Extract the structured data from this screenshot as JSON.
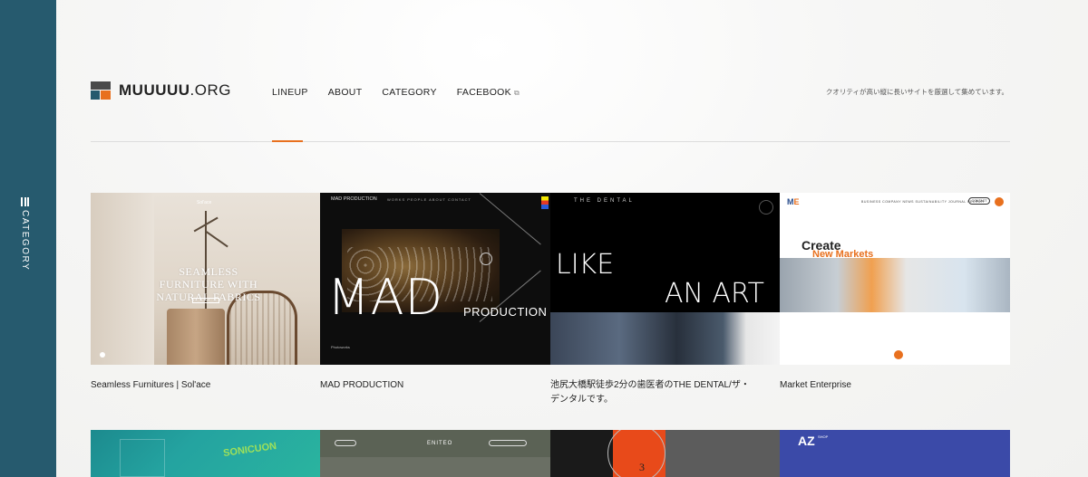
{
  "sidebar": {
    "label": "CATEGORY"
  },
  "header": {
    "logo_bold": "MUUUUU",
    "logo_rest": ".ORG",
    "nav": [
      {
        "label": "LINEUP"
      },
      {
        "label": "ABOUT"
      },
      {
        "label": "CATEGORY"
      },
      {
        "label": "FACEBOOK"
      }
    ],
    "tagline": "クオリティが高い縦に長いサイトを厳選して集めています。",
    "accent_color": "#e8701e",
    "sidebar_color": "#265a6e"
  },
  "cards": [
    {
      "caption": "Seamless Furnitures | Sol'ace",
      "thumb": {
        "brand": "Sol'ace",
        "headline": "SEAMLESS FURNITURE WITH NATURAL FABRICS"
      }
    },
    {
      "caption": "MAD PRODUCTION",
      "thumb": {
        "title": "MAD PRODUCTION",
        "nav": "WORKS   PEOPLE   ABOUT   CONTACT",
        "big": "MAD",
        "sub": "PRODUCTION",
        "foot": "Photoworks"
      }
    },
    {
      "caption": "池尻大橋駅徒歩2分の歯医者のTHE DENTAL/ザ・デンタルです。",
      "thumb": {
        "title": "THE DENTAL",
        "line1": "LIKE",
        "line2": "AN ART"
      }
    },
    {
      "caption": "Market Enterprise",
      "thumb": {
        "logo_m": "M",
        "logo_e": "E",
        "links": "BUSINESS   COMPANY   NEWS   SUSTAINABILITY   JOURNAL   RECRUIT",
        "contact": "CONTACT",
        "headline1": "Create",
        "headline2": "New Markets"
      }
    }
  ],
  "row2": [
    {
      "label": "SONICUON"
    },
    {
      "label": "ENITEO"
    },
    {
      "label": "3"
    },
    {
      "label": "AZ",
      "sub": "SHOP"
    }
  ]
}
